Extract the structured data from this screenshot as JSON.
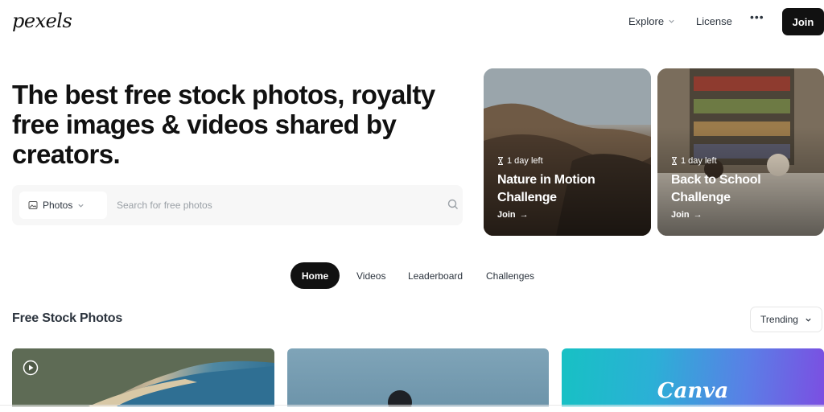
{
  "header": {
    "logo": "pexels",
    "nav": {
      "explore_label": "Explore",
      "license_label": "License",
      "more_label": "•••",
      "join_label": "Join"
    }
  },
  "hero": {
    "title": "The best free stock photos, royalty free images & videos shared by creators.",
    "search": {
      "type_label": "Photos",
      "placeholder": "Search for free photos"
    }
  },
  "challenges": [
    {
      "time_left": "1 day left",
      "title": "Nature in Motion Challenge",
      "join_label": "Join"
    },
    {
      "time_left": "1 day left",
      "title": "Back to School Challenge",
      "join_label": "Join"
    }
  ],
  "tabs": [
    {
      "label": "Home",
      "active": true
    },
    {
      "label": "Videos",
      "active": false
    },
    {
      "label": "Leaderboard",
      "active": false
    },
    {
      "label": "Challenges",
      "active": false
    }
  ],
  "section": {
    "title": "Free Stock Photos",
    "sort_label": "Trending"
  },
  "photos": [
    {
      "kind": "coastal-town-video"
    },
    {
      "kind": "person-sky"
    },
    {
      "kind": "canva-ad",
      "label": "Canva"
    }
  ],
  "colors": {
    "accent_dark": "#111111",
    "text": "#2c343e",
    "search_bg": "#f7f7f7"
  }
}
